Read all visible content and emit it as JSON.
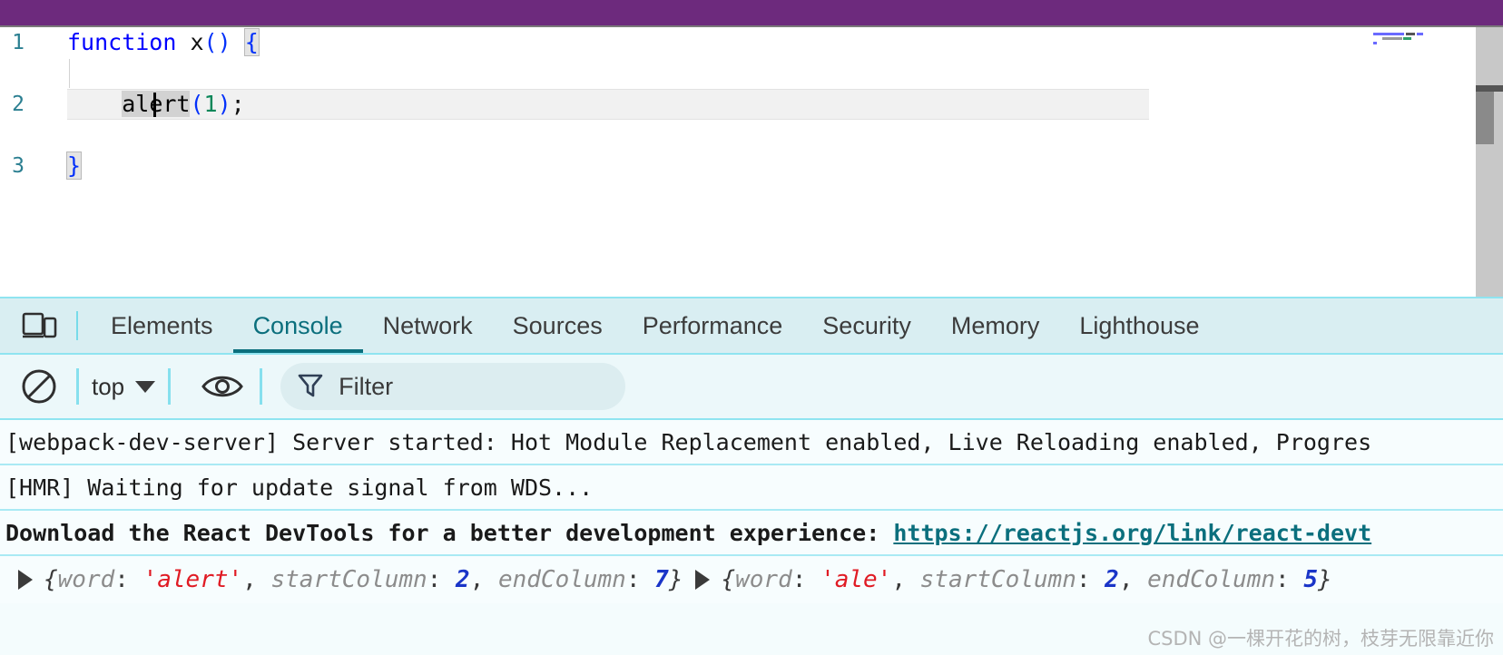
{
  "window": {
    "header_color": "#6d2a7d"
  },
  "editor": {
    "lines": [
      {
        "number": "1",
        "text": "function x() {"
      },
      {
        "number": "2",
        "text": "    alert(1);"
      },
      {
        "number": "3",
        "text": "}"
      }
    ],
    "line_numbers": {
      "one": "1",
      "two": "2",
      "three": "3"
    },
    "tokens": {
      "keyword": "function",
      "fname": " x",
      "parens": "()",
      "space": " ",
      "open_brace": "{",
      "indent": "    ",
      "sel_a": "ale",
      "sel_b": "rt",
      "call_open": "(",
      "number": "1",
      "call_close": ")",
      "semicolon": ";",
      "close_brace": "}"
    },
    "minimap": {
      "label": "minimap"
    },
    "scrollbar": {
      "label": "editor-vertical-scrollbar"
    }
  },
  "devtools": {
    "device_toggle": "device-toolbar-icon",
    "tabs": [
      {
        "label": "Elements",
        "active": false
      },
      {
        "label": "Console",
        "active": true
      },
      {
        "label": "Network",
        "active": false
      },
      {
        "label": "Sources",
        "active": false
      },
      {
        "label": "Performance",
        "active": false
      },
      {
        "label": "Security",
        "active": false
      },
      {
        "label": "Memory",
        "active": false
      },
      {
        "label": "Lighthouse",
        "active": false
      }
    ],
    "tab_labels": {
      "elements": "Elements",
      "console": "Console",
      "network": "Network",
      "sources": "Sources",
      "performance": "Performance",
      "security": "Security",
      "memory": "Memory",
      "lighthouse": "Lighthouse"
    },
    "toolbar": {
      "clear_icon": "clear-console-icon",
      "context_value": "top",
      "eye_icon": "eye-icon",
      "filter_icon": "funnel-icon",
      "filter_placeholder": "Filter"
    },
    "console": {
      "messages": [
        {
          "id": "webpack-dev-server",
          "text": "[webpack-dev-server] Server started: Hot Module Replacement enabled, Live Reloading enabled, Progres"
        },
        {
          "id": "hmr",
          "text": "[HMR] Waiting for update signal from WDS..."
        }
      ],
      "msg_webpack": "[webpack-dev-server] Server started: Hot Module Replacement enabled, Live Reloading enabled, Progres",
      "msg_hmr": "[HMR] Waiting for update signal from WDS...",
      "msg_react_prefix": "Download the React DevTools for a better development experience: ",
      "msg_react_link": "https://reactjs.org/link/react-devt",
      "objects": [
        {
          "open": "{",
          "key1": "word",
          "val1": "'alert'",
          "key2": "startColumn",
          "val2": "2",
          "key3": "endColumn",
          "val3": "7",
          "close": "}"
        },
        {
          "open": "{",
          "key1": "word",
          "val1": "'ale'",
          "key2": "startColumn",
          "val2": "2",
          "key3": "endColumn",
          "val3": "5",
          "close": "}"
        }
      ],
      "obj1": {
        "open": "{",
        "k1": "word",
        "v1": "'alert'",
        "k2": "startColumn",
        "v2": "2",
        "k3": "endColumn",
        "v3": "7",
        "close": "}",
        "sep": ", ",
        "colon": ": "
      },
      "obj2": {
        "open": "{",
        "k1": "word",
        "v1": "'ale'",
        "k2": "startColumn",
        "v2": "2",
        "k3": "endColumn",
        "v3": "5",
        "close": "}",
        "sep": ", ",
        "colon": ": "
      }
    }
  },
  "watermark": {
    "text": "CSDN @一棵开花的树，枝芽无限靠近你"
  },
  "colors": {
    "accent_teal": "#0b6f7d",
    "panel_bg": "#f4fcfd",
    "tabbar_bg": "#d9eef2",
    "separator": "#8fe4f0",
    "keyword_blue": "#0000ff",
    "number_green": "#098658",
    "string_red": "#e01b24",
    "num_blue": "#1a35c8",
    "header_purple": "#6d2a7d"
  }
}
